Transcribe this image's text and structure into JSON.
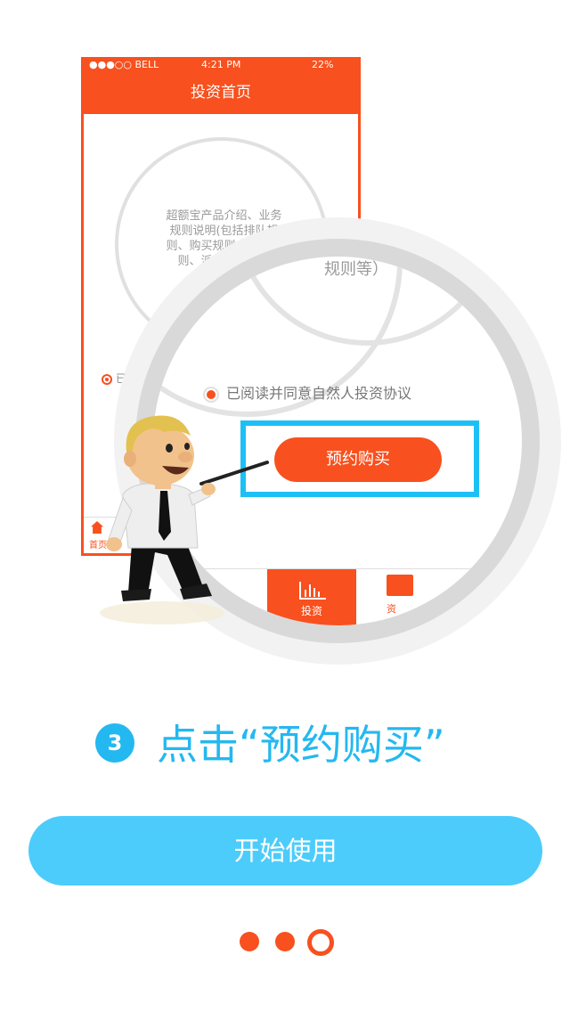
{
  "phone": {
    "status": {
      "carrier": "●●●○○ BELL",
      "time": "4:21 PM",
      "battery": "22%"
    },
    "nav_title": "投资首页",
    "intro_text": "超额宝产品介绍、业务规则说明(包括排队规则、购买规则、计息规则、派息规则等）",
    "agree_partial": "已阅读并",
    "tab_home": "首页"
  },
  "magnifier": {
    "rules_tail": "规则等）",
    "agree_text": "已阅读并同意自然人投资协议",
    "reserve_button": "预约购买",
    "tab_invest": "投资",
    "tab_info_partial": "资"
  },
  "step": {
    "number": "3",
    "title": "点击“预约购买”"
  },
  "start_button": "开始使用",
  "pager": {
    "total": 3,
    "current": 3
  },
  "colors": {
    "brand_orange": "#f8501e",
    "accent_blue": "#24b8f0",
    "button_blue": "#4cccfb"
  }
}
